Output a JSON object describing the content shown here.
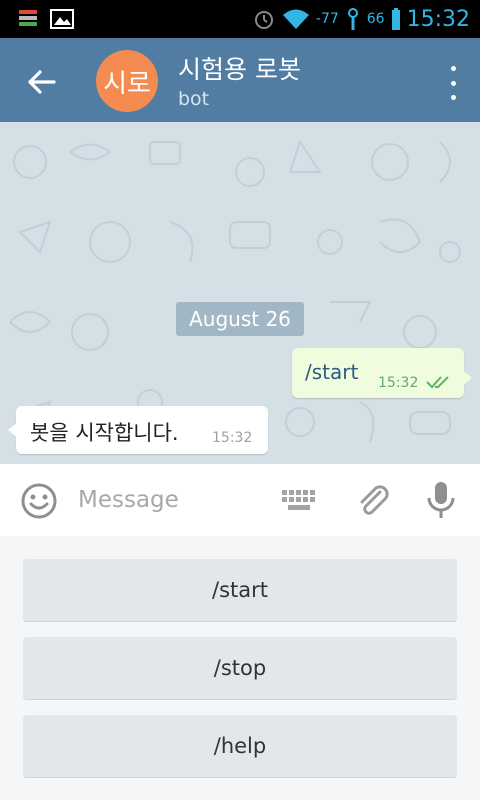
{
  "status_bar": {
    "signal": "-77",
    "battery": "66",
    "time": "15:32"
  },
  "header": {
    "avatar_initials": "시로",
    "title": "시험용 로봇",
    "subtitle": "bot",
    "colors": {
      "header_bg": "#527da3",
      "avatar_bg": "#f48c52"
    }
  },
  "chat": {
    "date_label": "August 26",
    "messages": [
      {
        "direction": "out",
        "text": "/start",
        "time": "15:32",
        "status": "read"
      },
      {
        "direction": "in",
        "text": "봇을 시작합니다.",
        "time": "15:32"
      }
    ]
  },
  "input": {
    "placeholder": "Message"
  },
  "bot_keyboard": {
    "buttons": [
      {
        "label": "/start"
      },
      {
        "label": "/stop"
      },
      {
        "label": "/help"
      }
    ]
  }
}
